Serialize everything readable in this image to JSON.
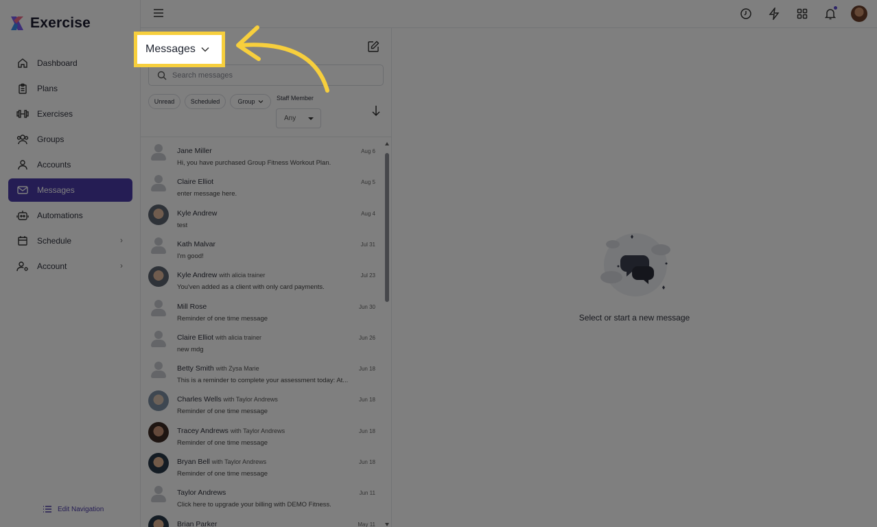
{
  "app": {
    "name": "Exercise"
  },
  "sidebar": {
    "items": [
      {
        "label": "Dashboard",
        "icon": "home-icon"
      },
      {
        "label": "Plans",
        "icon": "clipboard-icon"
      },
      {
        "label": "Exercises",
        "icon": "dumbbell-icon"
      },
      {
        "label": "Groups",
        "icon": "users-icon"
      },
      {
        "label": "Accounts",
        "icon": "user-icon"
      },
      {
        "label": "Messages",
        "icon": "mail-icon",
        "active": true
      },
      {
        "label": "Automations",
        "icon": "robot-icon"
      },
      {
        "label": "Schedule",
        "icon": "calendar-icon",
        "has_submenu": true
      },
      {
        "label": "Account",
        "icon": "user-settings-icon",
        "has_submenu": true
      }
    ],
    "edit_navigation": "Edit Navigation"
  },
  "topbar": {
    "icons": [
      "clock-icon",
      "lightning-icon",
      "apps-grid-icon",
      "bell-icon",
      "avatar"
    ]
  },
  "messages": {
    "title": "Messages",
    "search_placeholder": "Search messages",
    "filters": {
      "unread": "Unread",
      "scheduled": "Scheduled",
      "group": "Group"
    },
    "staff_member_label": "Staff Member",
    "staff_member_value": "Any",
    "threads": [
      {
        "name": "Jane Miller",
        "with": "",
        "preview": "Hi, you have purchased Group Fitness Workout Plan.",
        "date": "Aug 6",
        "avatar": "placeholder"
      },
      {
        "name": "Claire Elliot",
        "with": "",
        "preview": "enter message here.",
        "date": "Aug 5",
        "avatar": "placeholder"
      },
      {
        "name": "Kyle Andrew",
        "with": "",
        "preview": "test",
        "date": "Aug 4",
        "avatar": "photo1"
      },
      {
        "name": "Kath Malvar",
        "with": "",
        "preview": "I'm good!",
        "date": "Jul 31",
        "avatar": "placeholder"
      },
      {
        "name": "Kyle Andrew",
        "with": "with alicia trainer",
        "preview": "You'ven added as a client with only card payments.",
        "date": "Jul 23",
        "avatar": "photo1"
      },
      {
        "name": "Mill Rose",
        "with": "",
        "preview": "Reminder of one time message",
        "date": "Jun 30",
        "avatar": "placeholder"
      },
      {
        "name": "Claire Elliot",
        "with": "with alicia trainer",
        "preview": "new mdg",
        "date": "Jun 26",
        "avatar": "placeholder"
      },
      {
        "name": "Betty Smith",
        "with": "with Zysa Marie",
        "preview": "This is a reminder to complete your assessment today: At...",
        "date": "Jun 18",
        "avatar": "placeholder"
      },
      {
        "name": "Charles Wells",
        "with": "with Taylor Andrews",
        "preview": "Reminder of one time message",
        "date": "Jun 18",
        "avatar": "photo2"
      },
      {
        "name": "Tracey Andrews",
        "with": "with Taylor Andrews",
        "preview": "Reminder of one time message",
        "date": "Jun 18",
        "avatar": "photo3"
      },
      {
        "name": "Bryan Bell",
        "with": "with Taylor Andrews",
        "preview": "Reminder of one time message",
        "date": "Jun 18",
        "avatar": "photo4"
      },
      {
        "name": "Taylor Andrews",
        "with": "",
        "preview": "Click here to upgrade your billing with DEMO Fitness.",
        "date": "Jun 11",
        "avatar": "placeholder"
      },
      {
        "name": "Brian Parker",
        "with": "",
        "preview": "",
        "date": "May 11",
        "avatar": "photo4"
      }
    ]
  },
  "empty_state": {
    "text": "Select or start a new message"
  },
  "colors": {
    "accent": "#4a3aa8",
    "highlight": "#f7cf3d",
    "notification_dot": "#5b4ad0"
  }
}
